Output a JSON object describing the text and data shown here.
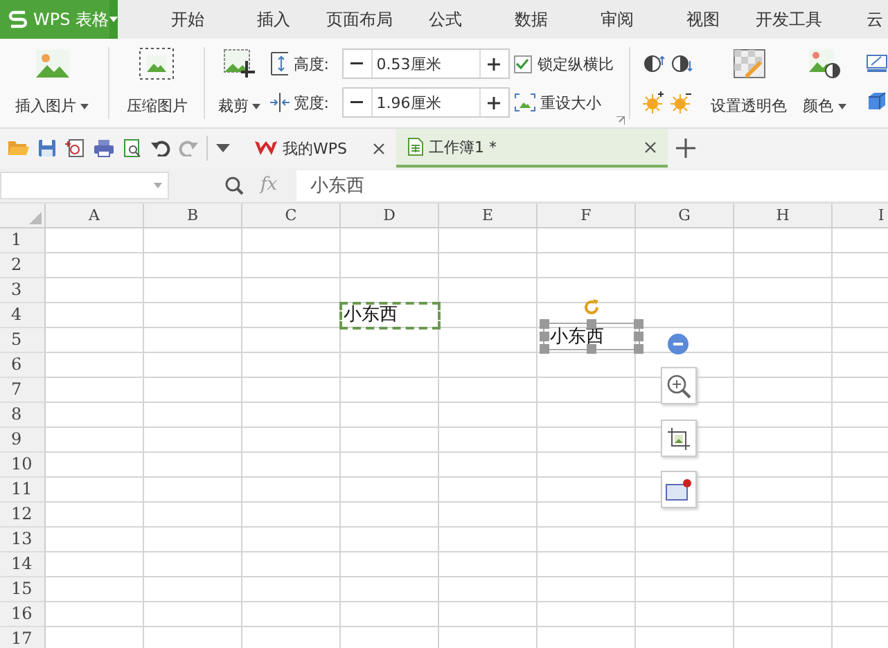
{
  "app_menu": {
    "brand": "WPS 表格"
  },
  "menu_tabs": [
    {
      "label": "开始",
      "selected": false
    },
    {
      "label": "插入",
      "selected": false
    },
    {
      "label": "页面布局",
      "selected": false
    },
    {
      "label": "公式",
      "selected": false
    },
    {
      "label": "数据",
      "selected": false
    },
    {
      "label": "审阅",
      "selected": false
    },
    {
      "label": "视图",
      "selected": false
    },
    {
      "label": "开发工具",
      "selected": false
    },
    {
      "label": "云",
      "selected": false
    }
  ],
  "ribbon": {
    "insert_picture": "插入图片",
    "compress_picture": "压缩图片",
    "crop": "裁剪",
    "height": {
      "label": "高度:",
      "value": "0.53厘米"
    },
    "width": {
      "label": "宽度:",
      "value": "1.96厘米"
    },
    "lock_ratio": {
      "label": "锁定纵横比",
      "checked": true
    },
    "reset_size": "重设大小",
    "set_transparent": "设置透明色",
    "color_menu": "颜色"
  },
  "doc_tabs": [
    {
      "label": "我的WPS",
      "kind": "home",
      "selected": false
    },
    {
      "label": "工作簿1 *",
      "kind": "workbook",
      "selected": true
    }
  ],
  "formula_bar": {
    "function_label": "fx",
    "content": "小东西"
  },
  "sheet": {
    "columns": [
      "A",
      "B",
      "C",
      "D",
      "E",
      "F",
      "G",
      "H",
      "I"
    ],
    "rows": [
      {
        "label": "1"
      },
      {
        "label": "2"
      },
      {
        "label": "3"
      },
      {
        "label": "4",
        "cells": [
          null,
          null,
          null,
          {
            "text": "小东西",
            "kind": "copy_marquee"
          }
        ]
      },
      {
        "label": "5"
      },
      {
        "label": "6"
      },
      {
        "label": "7"
      },
      {
        "label": "8"
      },
      {
        "label": "9"
      },
      {
        "label": "10"
      },
      {
        "label": "11"
      },
      {
        "label": "12"
      },
      {
        "label": "13"
      },
      {
        "label": "14"
      },
      {
        "label": "15"
      },
      {
        "label": "16"
      },
      {
        "label": "17"
      }
    ],
    "picture": {
      "text": "小东西",
      "selected": true
    }
  }
}
